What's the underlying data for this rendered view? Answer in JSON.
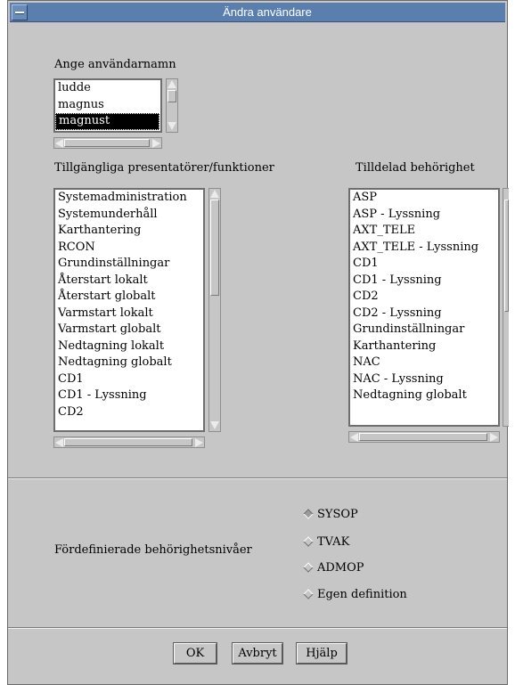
{
  "window": {
    "title": "Ändra användare"
  },
  "username": {
    "label": "Ange användarnamn",
    "items": [
      "ludde",
      "magnus",
      "magnust"
    ],
    "selected": "magnust"
  },
  "available": {
    "label": "Tillgängliga presentatörer/funktioner",
    "items": [
      "Systemadministration",
      "Systemunderhåll",
      "Karthantering",
      "RCON",
      "Grundinställningar",
      "Återstart lokalt",
      "Återstart globalt",
      "Varmstart lokalt",
      "Varmstart globalt",
      "Nedtagning lokalt",
      "Nedtagning globalt",
      "CD1",
      "CD1 - Lyssning",
      "CD2"
    ]
  },
  "assigned": {
    "label": "Tilldelad behörighet",
    "items": [
      "ASP",
      "ASP - Lyssning",
      "AXT_TELE",
      "AXT_TELE - Lyssning",
      "CD1",
      "CD1 - Lyssning",
      "CD2",
      "CD2 - Lyssning",
      "Grundinställningar",
      "Karthantering",
      "NAC",
      "NAC - Lyssning",
      "Nedtagning globalt"
    ]
  },
  "levels": {
    "label": "Fördefinierade behörighetsnivåer",
    "options": [
      "SYSOP",
      "TVAK",
      "ADMOP",
      "Egen definition"
    ],
    "selected": "SYSOP"
  },
  "buttons": {
    "ok": "OK",
    "cancel": "Avbryt",
    "help": "Hjälp"
  },
  "colors": {
    "titlebar": "#5a7faf",
    "window": "#c6c6c6",
    "selection": "#000000"
  }
}
